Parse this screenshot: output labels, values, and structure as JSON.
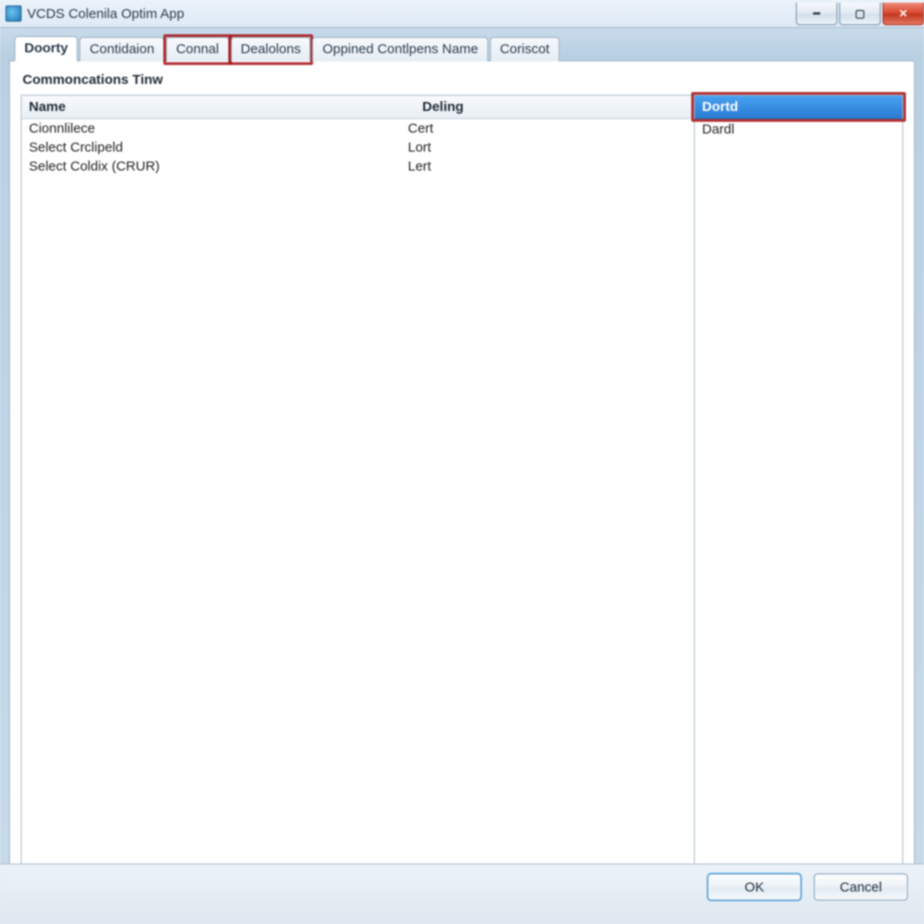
{
  "window": {
    "title": "VCDS Colenila Optim App"
  },
  "tabs": {
    "t0": "Doorty",
    "t1": "Contidaion",
    "t2": "Connal",
    "t3": "Dealolons",
    "t4": "Oppined Contlpens Name",
    "t5": "Coriscot"
  },
  "section": {
    "label": "Commoncations Tinw"
  },
  "left_table": {
    "headers": {
      "name": "Name",
      "deling": "Deling"
    },
    "rows": [
      {
        "name": "Cionnlilece",
        "deling": "Cert"
      },
      {
        "name": "Select Crclipeld",
        "deling": "Lort"
      },
      {
        "name": "Select Coldix (CRUR)",
        "deling": "Lert"
      }
    ]
  },
  "right_list": {
    "header": "Dortd",
    "items": [
      "Dardl"
    ]
  },
  "buttons": {
    "ok": "OK",
    "cancel": "Cancel"
  }
}
